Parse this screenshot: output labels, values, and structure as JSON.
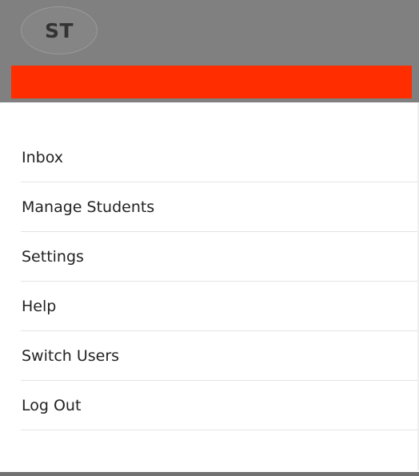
{
  "header": {
    "avatar_initials": "ST",
    "background_color": "#808080",
    "redaction_color": "#ff2d00"
  },
  "menu": {
    "items": [
      {
        "label": "Inbox"
      },
      {
        "label": "Manage Students"
      },
      {
        "label": "Settings"
      },
      {
        "label": "Help"
      },
      {
        "label": "Switch Users"
      },
      {
        "label": "Log Out"
      }
    ]
  }
}
